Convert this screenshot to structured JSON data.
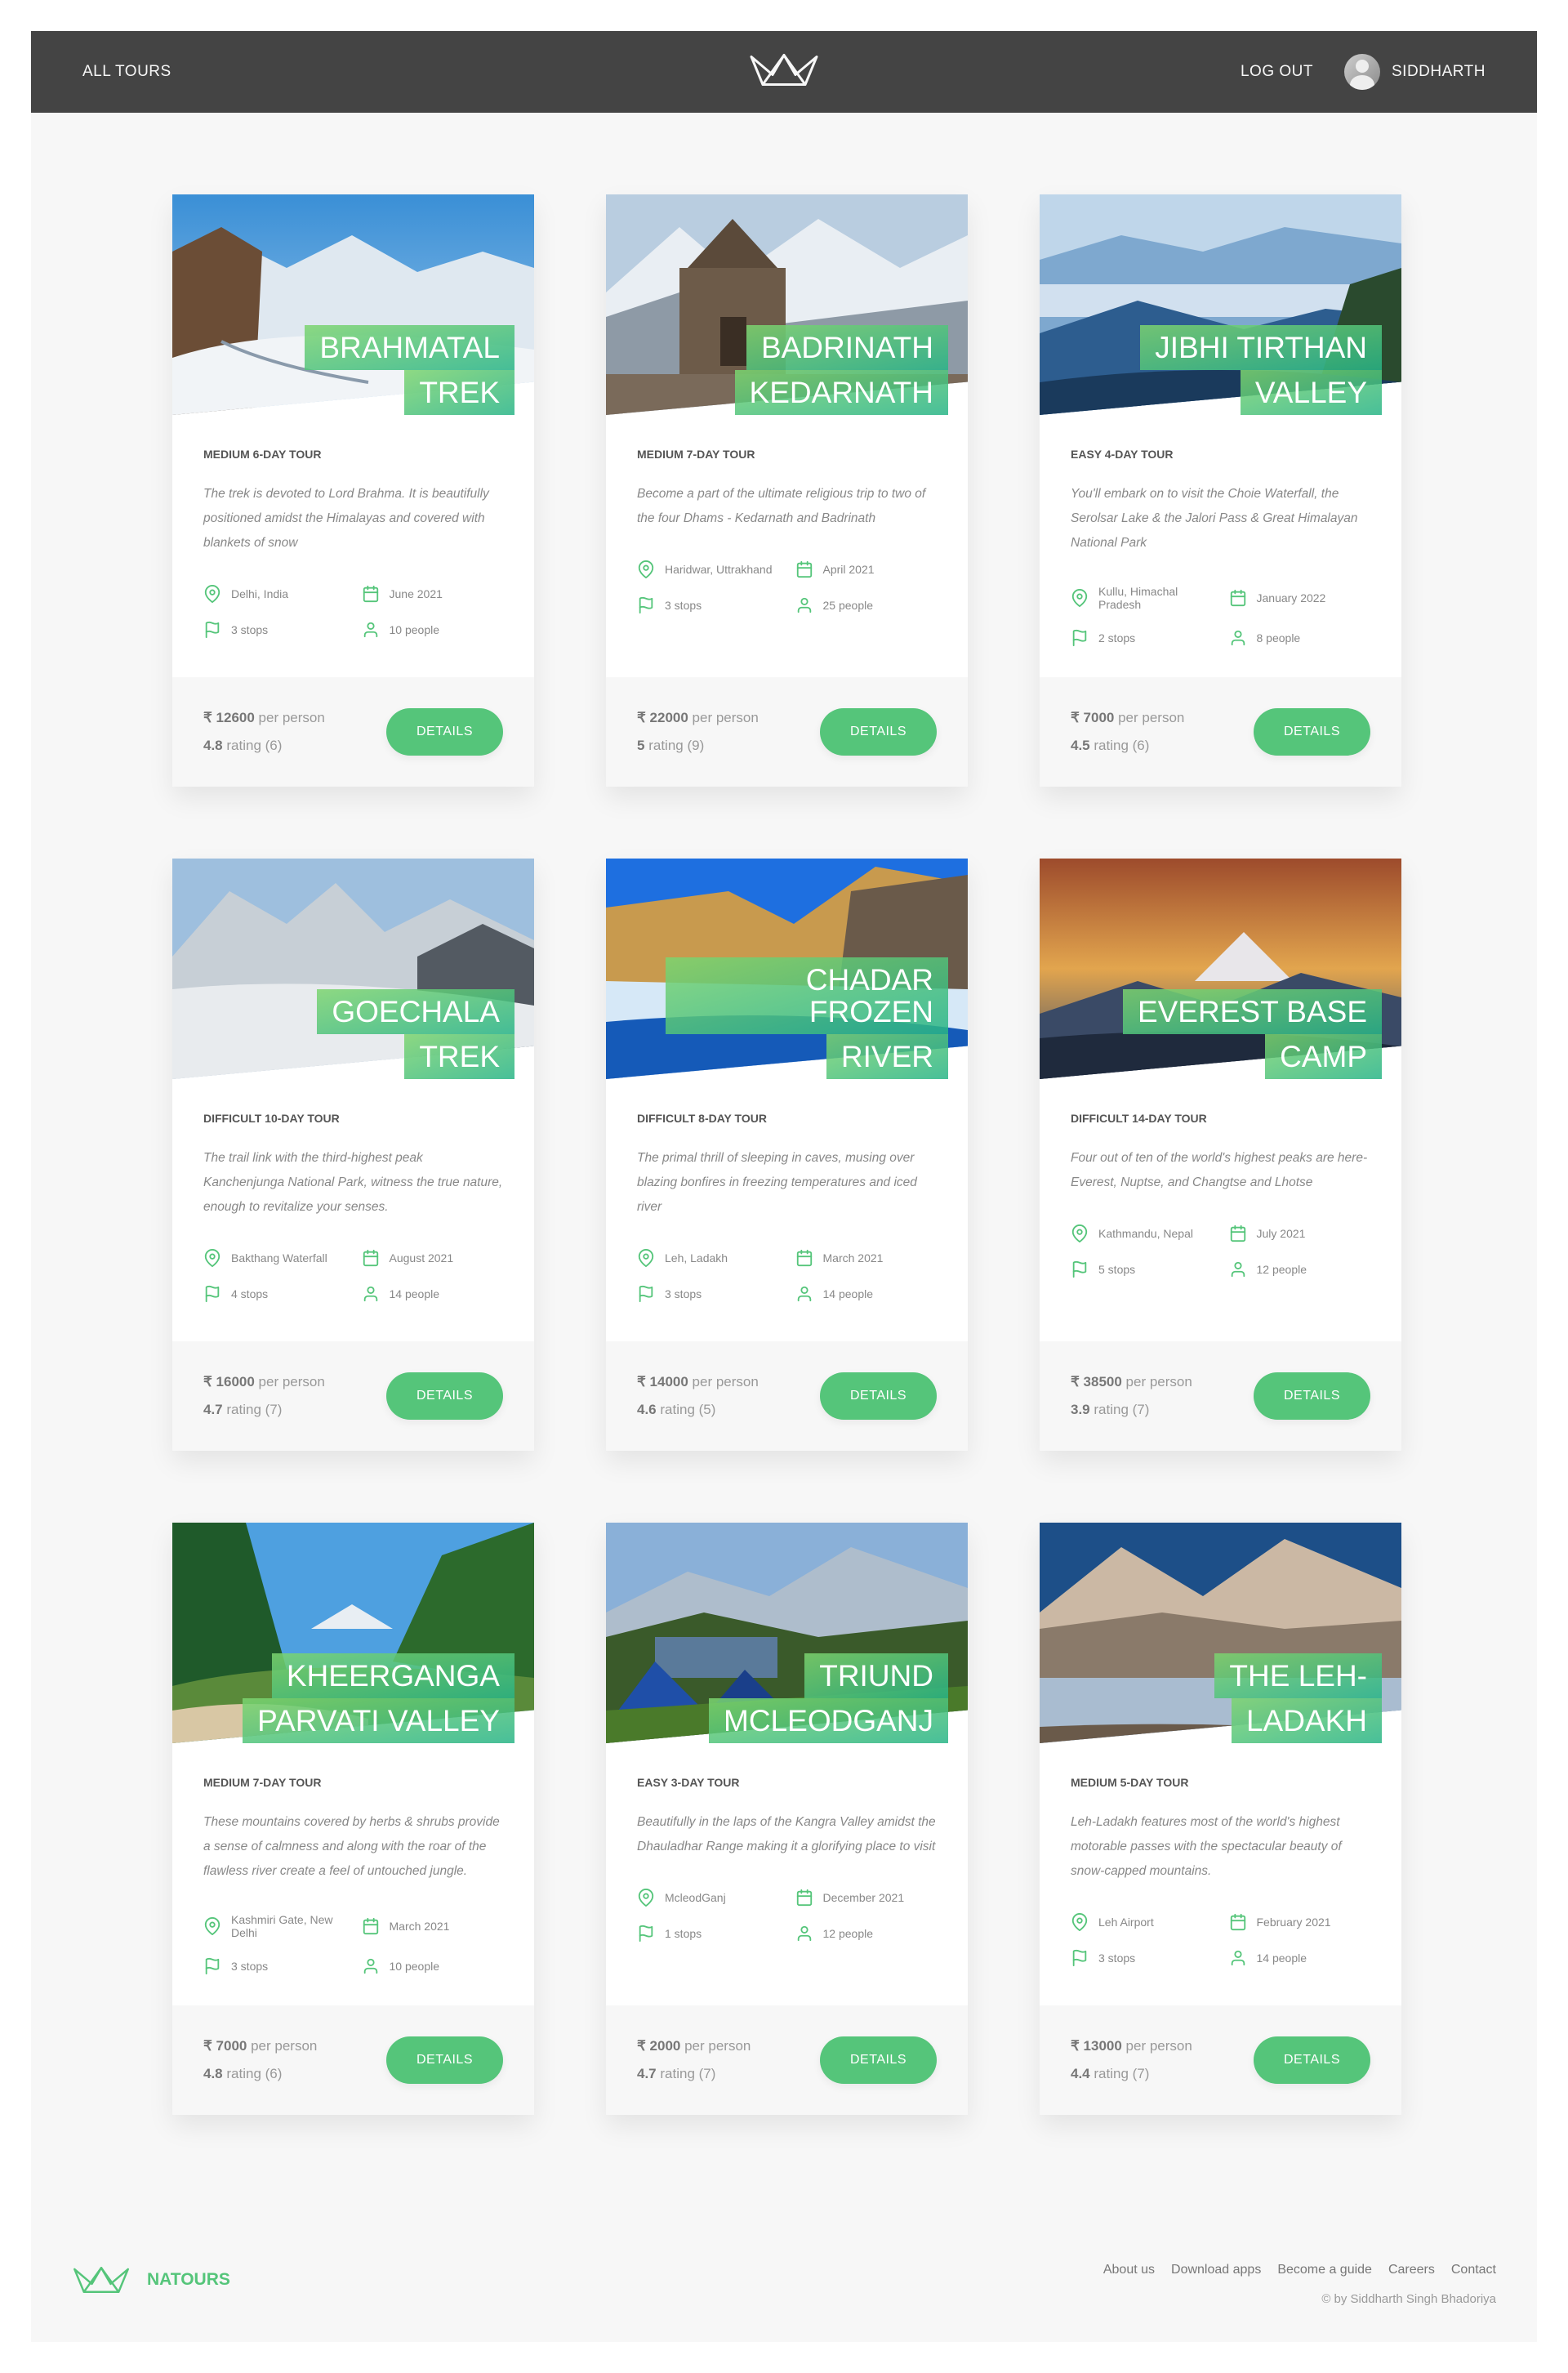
{
  "nav": {
    "all_tours": "ALL TOURS",
    "logout": "LOG OUT",
    "user": "SIDDHARTH"
  },
  "tours": [
    {
      "title": [
        "BRAHMATAL",
        "TREK"
      ],
      "subtitle": "MEDIUM 6-DAY TOUR",
      "summary": "The trek is devoted to Lord Brahma. It is beautifully positioned amidst the Himalayas and covered with blankets of snow",
      "location": "Delhi, India",
      "date": "June 2021",
      "stops": "3 stops",
      "people": "10 people",
      "price": "₹ 12600",
      "per": "per person",
      "rating": "4.8",
      "rating_label": "rating (6)",
      "details": "DETAILS",
      "scene": "snow"
    },
    {
      "title": [
        "BADRINATH",
        "KEDARNATH"
      ],
      "subtitle": "MEDIUM 7-DAY TOUR",
      "summary": "Become a part of the ultimate religious trip to two of the four Dhams - Kedarnath and Badrinath",
      "location": "Haridwar, Uttrakhand",
      "date": "April 2021",
      "stops": "3 stops",
      "people": "25 people",
      "price": "₹ 22000",
      "per": "per person",
      "rating": "5",
      "rating_label": "rating (9)",
      "details": "DETAILS",
      "scene": "temple"
    },
    {
      "title": [
        "JIBHI TIRTHAN",
        "VALLEY"
      ],
      "subtitle": "EASY 4-DAY TOUR",
      "summary": "You'll embark on to visit the Choie Waterfall, the Serolsar Lake & the Jalori Pass & Great Himalayan National Park",
      "location": "Kullu, Himachal Pradesh",
      "date": "January 2022",
      "stops": "2 stops",
      "people": "8 people",
      "price": "₹ 7000",
      "per": "per person",
      "rating": "4.5",
      "rating_label": "rating (6)",
      "details": "DETAILS",
      "scene": "blue"
    },
    {
      "title": [
        "GOECHALA",
        "TREK"
      ],
      "subtitle": "DIFFICULT 10-DAY TOUR",
      "summary": "The trail link with the third-highest peak Kanchenjunga National Park, witness the true nature, enough to revitalize your senses.",
      "location": "Bakthang Waterfall",
      "date": "August 2021",
      "stops": "4 stops",
      "people": "14 people",
      "price": "₹ 16000",
      "per": "per person",
      "rating": "4.7",
      "rating_label": "rating (7)",
      "details": "DETAILS",
      "scene": "grey"
    },
    {
      "title": [
        "CHADAR FROZEN",
        "RIVER"
      ],
      "subtitle": "DIFFICULT 8-DAY TOUR",
      "summary": "The primal thrill of sleeping in caves, musing over blazing bonfires in freezing temperatures and iced river",
      "location": "Leh, Ladakh",
      "date": "March 2021",
      "stops": "3 stops",
      "people": "14 people",
      "price": "₹ 14000",
      "per": "per person",
      "rating": "4.6",
      "rating_label": "rating (5)",
      "details": "DETAILS",
      "scene": "frozen"
    },
    {
      "title": [
        "EVEREST BASE",
        "CAMP"
      ],
      "subtitle": "DIFFICULT 14-DAY TOUR",
      "summary": "Four out of ten of the world's highest peaks are here- Everest, Nuptse, and Changtse and Lhotse",
      "location": "Kathmandu, Nepal",
      "date": "July 2021",
      "stops": "5 stops",
      "people": "12 people",
      "price": "₹ 38500",
      "per": "per person",
      "rating": "3.9",
      "rating_label": "rating (7)",
      "details": "DETAILS",
      "scene": "sunset"
    },
    {
      "title": [
        "KHEERGANGA",
        "PARVATI VALLEY"
      ],
      "subtitle": "MEDIUM 7-DAY TOUR",
      "summary": "These mountains covered by herbs & shrubs provide a sense of calmness and along with the roar of the flawless river create a feel of untouched jungle.",
      "location": "Kashmiri Gate, New Delhi",
      "date": "March 2021",
      "stops": "3 stops",
      "people": "10 people",
      "price": "₹ 7000",
      "per": "per person",
      "rating": "4.8",
      "rating_label": "rating (6)",
      "details": "DETAILS",
      "scene": "forest"
    },
    {
      "title": [
        "TRIUND",
        "MCLEODGANJ"
      ],
      "subtitle": "EASY 3-DAY TOUR",
      "summary": "Beautifully in the laps of the Kangra Valley amidst the Dhauladhar Range making it a glorifying place to visit",
      "location": "McleodGanj",
      "date": "December 2021",
      "stops": "1 stops",
      "people": "12 people",
      "price": "₹ 2000",
      "per": "per person",
      "rating": "4.7",
      "rating_label": "rating (7)",
      "details": "DETAILS",
      "scene": "camp"
    },
    {
      "title": [
        "THE LEH-",
        "LADAKH"
      ],
      "subtitle": "MEDIUM 5-DAY TOUR",
      "summary": "Leh-Ladakh features most of the world's highest motorable passes with the spectacular beauty of snow-capped mountains.",
      "location": "Leh Airport",
      "date": "February 2021",
      "stops": "3 stops",
      "people": "14 people",
      "price": "₹ 13000",
      "per": "per person",
      "rating": "4.4",
      "rating_label": "rating (7)",
      "details": "DETAILS",
      "scene": "lake"
    }
  ],
  "footer": {
    "brand": "NATOURS",
    "links": [
      "About us",
      "Download apps",
      "Become a guide",
      "Careers",
      "Contact"
    ],
    "copyright": "© by Siddharth Singh Bhadoriya"
  },
  "colors": {
    "accent": "#55c57a",
    "nav_bg": "#444444",
    "page_bg": "#f7f7f7"
  }
}
